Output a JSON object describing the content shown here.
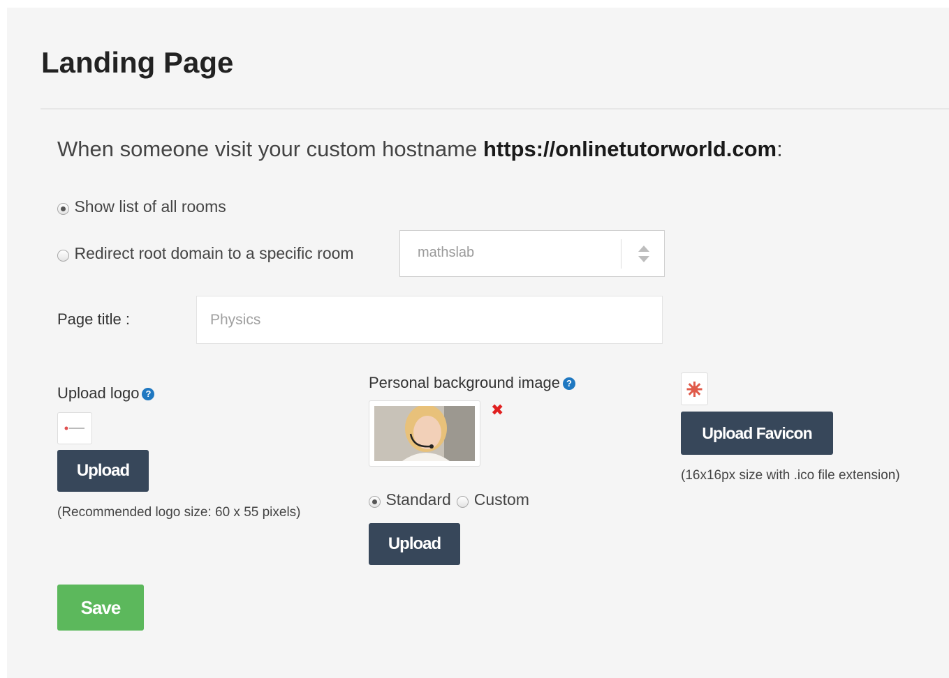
{
  "header": {
    "title": "Landing Page"
  },
  "intro": {
    "text": "When someone visit your custom hostname ",
    "hostname": "https://onlinetutorworld.com",
    "suffix": ":"
  },
  "landing_options": {
    "show_list_label": "Show list of all rooms",
    "show_list_checked": true,
    "redirect_label": "Redirect root domain to a specific room",
    "redirect_checked": false,
    "room_select_value": "mathslab"
  },
  "page_title_field": {
    "label": "Page title :",
    "placeholder": "Physics"
  },
  "logo": {
    "label": "Upload logo",
    "help_glyph": "?",
    "upload_label": "Upload",
    "note": "(Recommended logo size: 60 x 55 pixels)"
  },
  "background": {
    "label": "Personal background image",
    "help_glyph": "?",
    "remove_glyph": "✖",
    "standard_label": "Standard",
    "standard_checked": true,
    "custom_label": "Custom",
    "custom_checked": false,
    "upload_label": "Upload"
  },
  "favicon": {
    "upload_label": "Upload Favicon",
    "note": "(16x16px size with .ico file extension)"
  },
  "actions": {
    "save_label": "Save"
  },
  "colors": {
    "primary_button": "#37475a",
    "save_button": "#5cb85c",
    "help_icon": "#1f78c1",
    "remove_icon": "#e02020"
  }
}
